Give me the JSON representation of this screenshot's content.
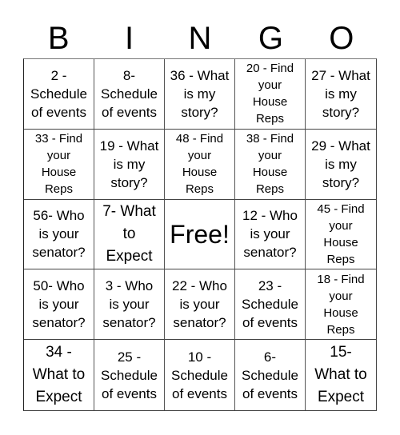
{
  "header": {
    "letters": [
      "B",
      "I",
      "N",
      "G",
      "O"
    ]
  },
  "cells": [
    {
      "text": "2 -\nSchedule\nof events",
      "size": "md"
    },
    {
      "text": "8-\nSchedule\nof events",
      "size": "md"
    },
    {
      "text": "36 - What\nis my\nstory?",
      "size": "md"
    },
    {
      "text": "20 - Find\nyour\nHouse\nReps",
      "size": "sm"
    },
    {
      "text": "27 - What\nis my\nstory?",
      "size": "md"
    },
    {
      "text": "33 - Find\nyour\nHouse\nReps",
      "size": "sm"
    },
    {
      "text": "19 - What\nis my\nstory?",
      "size": "md"
    },
    {
      "text": "48 - Find\nyour\nHouse\nReps",
      "size": "sm"
    },
    {
      "text": "38 - Find\nyour\nHouse\nReps",
      "size": "sm"
    },
    {
      "text": "29 - What\nis my\nstory?",
      "size": "md"
    },
    {
      "text": "56- Who\nis your\nsenator?",
      "size": "md"
    },
    {
      "text": "7- What\nto\nExpect",
      "size": "lg"
    },
    {
      "text": "Free!",
      "size": "free"
    },
    {
      "text": "12 - Who\nis your\nsenator?",
      "size": "md"
    },
    {
      "text": "45 - Find\nyour\nHouse\nReps",
      "size": "sm"
    },
    {
      "text": "50- Who\nis your\nsenator?",
      "size": "md"
    },
    {
      "text": "3 - Who\nis your\nsenator?",
      "size": "md"
    },
    {
      "text": "22 - Who\nis your\nsenator?",
      "size": "md"
    },
    {
      "text": "23 -\nSchedule\nof events",
      "size": "md"
    },
    {
      "text": "18 - Find\nyour\nHouse\nReps",
      "size": "sm"
    },
    {
      "text": "34 -\nWhat to\nExpect",
      "size": "lg"
    },
    {
      "text": "25 -\nSchedule\nof events",
      "size": "md"
    },
    {
      "text": "10 -\nSchedule\nof events",
      "size": "md"
    },
    {
      "text": "6-\nSchedule\nof events",
      "size": "md"
    },
    {
      "text": "15-\nWhat to\nExpect",
      "size": "lg"
    }
  ]
}
